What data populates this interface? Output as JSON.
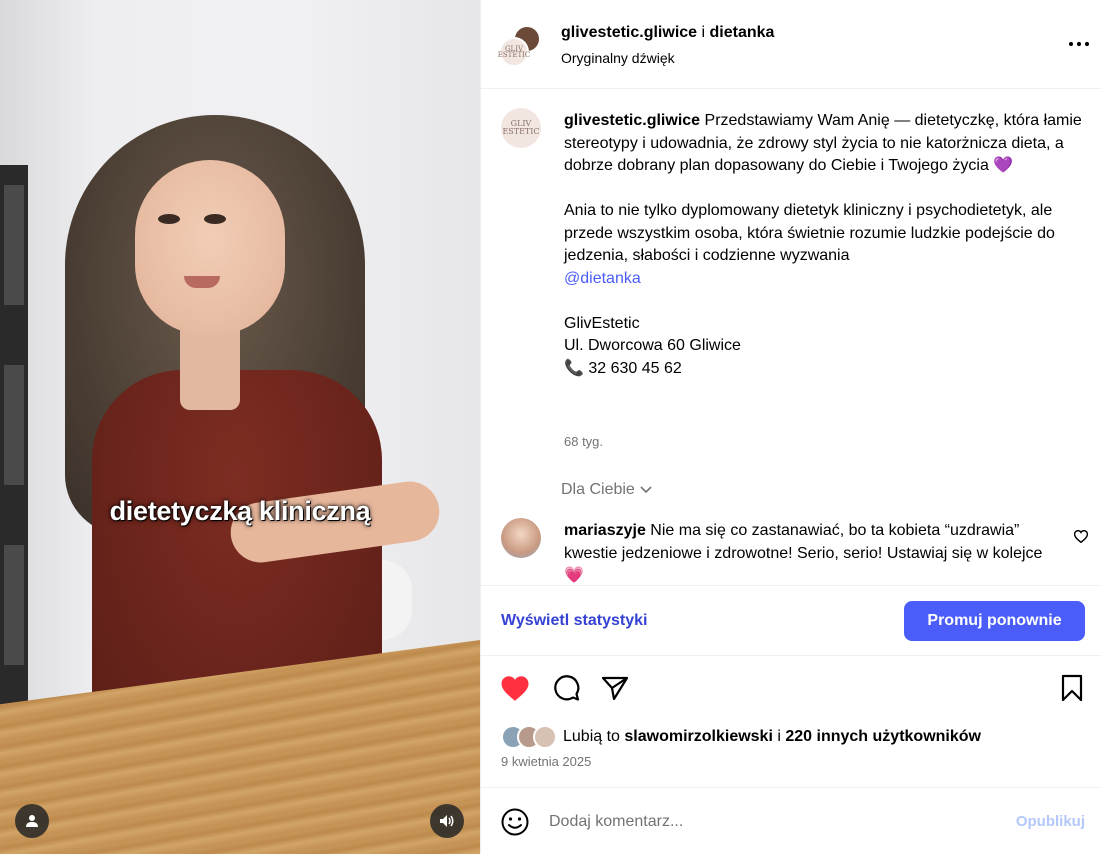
{
  "video": {
    "caption": "dietetyczką kliniczną",
    "user_icon": "user-icon",
    "sound_icon": "speaker-icon"
  },
  "header": {
    "account1": "glivestetic.gliwice",
    "separator": "i",
    "account2": "dietanka",
    "audio": "Oryginalny dźwięk",
    "logo_text": "GLIV ESTETIC"
  },
  "post": {
    "username": "glivestetic.gliwice",
    "paragraph1": "Przedstawiamy Wam Anię — dietetyczkę, która łamie stereotypy i udowadnia, że zdrowy styl życia to nie katorżnicza dieta, a dobrze dobrany plan dopasowany do Ciebie i Twojego życia",
    "paragraph1_emoji": "💜",
    "paragraph2": "Ania to nie tylko dyplomowany dietetyk kliniczny i psychodietetyk, ale przede wszystkim osoba, która świetnie rozumie ludzkie podejście do jedzenia, słabości i codzienne wyzwania",
    "mention": "@dietanka",
    "business_name": "GlivEstetic",
    "address": "Ul. Dworcowa 60 Gliwice",
    "phone_emoji": "📞",
    "phone": "32 630 45 62",
    "time": "68 tyg."
  },
  "for_you": "Dla Ciebie",
  "comment": {
    "username": "mariaszyje",
    "text": "Nie ma się co zastanawiać, bo ta kobieta “uzdrawia” kwestie jedzeniowe i zdrowotne! Serio, serio! Ustawiaj się w kolejce",
    "emoji": "💗"
  },
  "stats": {
    "view_stats": "Wyświetl statystyki",
    "promote_again": "Promuj ponownie"
  },
  "likes": {
    "prefix": "Lubią to",
    "user": "slawomirzolkiewski",
    "and": "i",
    "others": "220 innych użytkowników"
  },
  "date": "9 kwietnia 2025",
  "comment_box": {
    "placeholder": "Dodaj komentarz...",
    "publish": "Opublikuj"
  },
  "colors": {
    "accent": "#4a5df9",
    "link": "#3542d4",
    "heart": "#ff3040",
    "muted": "#737373",
    "publish_disabled": "#b3c7fa"
  }
}
